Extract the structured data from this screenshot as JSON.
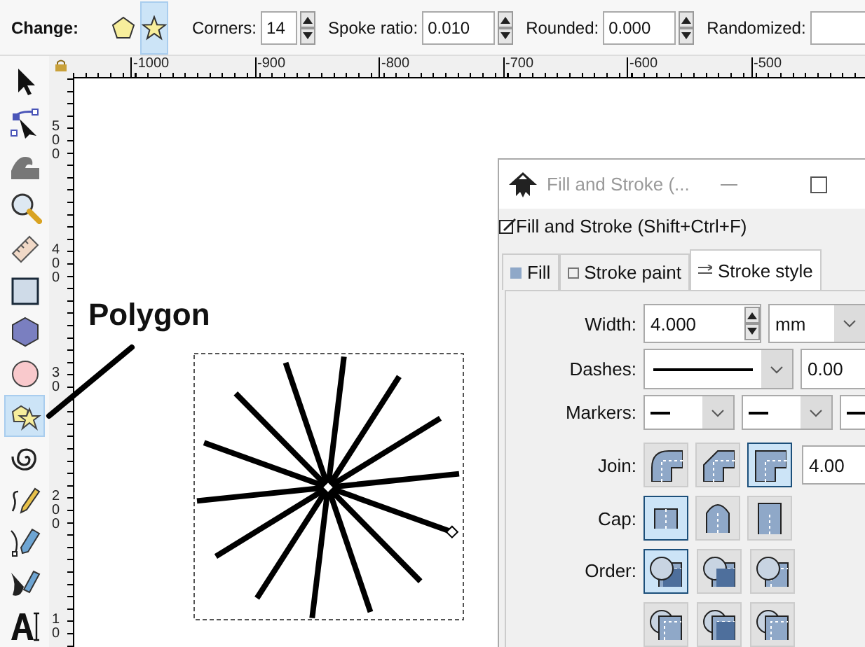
{
  "toolbar": {
    "label": "Change:",
    "modes": [
      {
        "kind": "polygon",
        "selected": false
      },
      {
        "kind": "star",
        "selected": true
      }
    ],
    "fields": [
      {
        "label": "Corners:",
        "value": "14"
      },
      {
        "label": "Spoke ratio:",
        "value": "0.010"
      },
      {
        "label": "Rounded:",
        "value": "0.000"
      },
      {
        "label": "Randomized:"
      }
    ]
  },
  "tools": [
    {
      "kind": "selector",
      "selected": false
    },
    {
      "kind": "node",
      "selected": false
    },
    {
      "kind": "tweak",
      "selected": false
    },
    {
      "kind": "zoom",
      "selected": false
    },
    {
      "kind": "measure",
      "selected": false
    },
    {
      "kind": "rect",
      "selected": false
    },
    {
      "kind": "box3d",
      "selected": false
    },
    {
      "kind": "ellipse",
      "selected": false
    },
    {
      "kind": "star",
      "selected": true
    },
    {
      "kind": "spiral",
      "selected": false
    },
    {
      "kind": "pencil",
      "selected": false
    },
    {
      "kind": "pen",
      "selected": false
    },
    {
      "kind": "calligraphy",
      "selected": false
    },
    {
      "kind": "text",
      "selected": false
    }
  ],
  "ruler_top": {
    "labels": [
      "-1000",
      "-900",
      "-800",
      "-700",
      "-600",
      "-500"
    ]
  },
  "ruler_left": {
    "labels": [
      "500",
      "400",
      "30",
      "200",
      "10"
    ]
  },
  "canvas": {
    "annotation": "Polygon"
  },
  "dialog": {
    "title": "Fill and Stroke (...",
    "header": "Fill and Stroke (Shift+Ctrl+F)",
    "tabs": [
      {
        "kind": "fill",
        "label": "Fill",
        "selected": false
      },
      {
        "kind": "paint",
        "label": "Stroke paint",
        "selected": false
      },
      {
        "kind": "style",
        "label": "Stroke style",
        "selected": true
      }
    ],
    "width": {
      "label": "Width:",
      "value": "4.000",
      "unit": "mm"
    },
    "dashes": {
      "label": "Dashes:",
      "value": "0.00"
    },
    "markers": {
      "label": "Markers:"
    },
    "join": {
      "label": "Join:",
      "value": "4.00",
      "options": [
        {
          "kind": "round",
          "selected": false
        },
        {
          "kind": "bevel",
          "selected": false
        },
        {
          "kind": "miter",
          "selected": true
        }
      ]
    },
    "cap": {
      "label": "Cap:",
      "options": [
        {
          "kind": "butt",
          "selected": true
        },
        {
          "kind": "round",
          "selected": false
        },
        {
          "kind": "square",
          "selected": false
        }
      ]
    },
    "order": {
      "label": "Order:",
      "options": [
        {
          "kind": "fill-stroke-markers",
          "selected": true
        },
        {
          "kind": "stroke-fill-markers",
          "selected": false
        },
        {
          "kind": "fill-markers-stroke",
          "selected": false
        },
        {
          "kind": "markers-fill-stroke",
          "selected": false
        },
        {
          "kind": "stroke-markers-fill",
          "selected": false
        },
        {
          "kind": "markers-stroke-fill",
          "selected": false
        }
      ]
    }
  }
}
